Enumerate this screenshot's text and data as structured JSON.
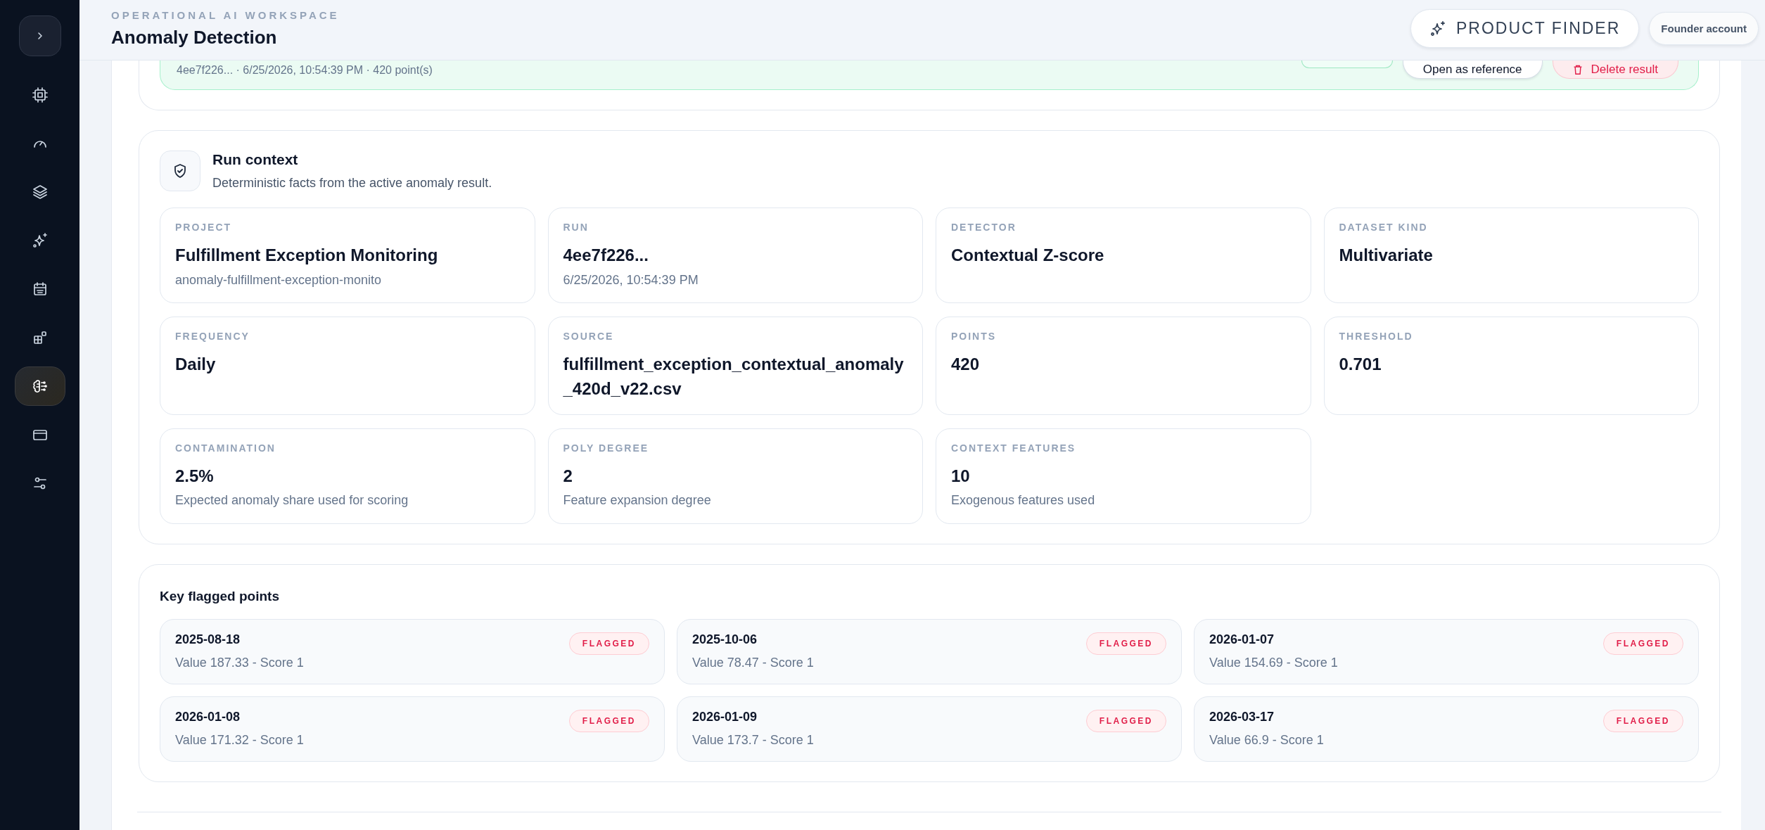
{
  "sidebar": {
    "items": [
      {
        "selected": false
      },
      {
        "selected": false
      },
      {
        "selected": false
      },
      {
        "selected": false
      },
      {
        "selected": false
      },
      {
        "selected": false
      },
      {
        "selected": true
      },
      {
        "selected": false
      },
      {
        "selected": false
      }
    ]
  },
  "header": {
    "eyebrow": "OPERATIONAL AI WORKSPACE",
    "title": "Anomaly Detection",
    "product_finder": "PRODUCT FINDER",
    "account": "Founder account"
  },
  "result_banner": {
    "meta": "4ee7f226... · 6/25/2026, 10:54:39 PM · 420 point(s)",
    "buttons": [
      {
        "kind": "plain"
      },
      {
        "kind": "secondary",
        "label": "Open as reference"
      },
      {
        "kind": "danger",
        "label": "Delete result"
      }
    ]
  },
  "run_context": {
    "title": "Run context",
    "subtitle": "Deterministic facts from the active anomaly result.",
    "facts": [
      {
        "label": "PROJECT",
        "value": "Fulfillment Exception Monitoring",
        "detail": "anomaly-fulfillment-exception-monito"
      },
      {
        "label": "RUN",
        "value": "4ee7f226...",
        "detail": "6/25/2026, 10:54:39 PM"
      },
      {
        "label": "DETECTOR",
        "value": "Contextual Z-score"
      },
      {
        "label": "DATASET KIND",
        "value": "Multivariate"
      },
      {
        "label": "FREQUENCY",
        "value": "Daily"
      },
      {
        "label": "SOURCE",
        "value": "fulfillment_exception_contextual_anomaly_420d_v22.csv"
      },
      {
        "label": "POINTS",
        "value": "420"
      },
      {
        "label": "THRESHOLD",
        "value": "0.701"
      },
      {
        "label": "CONTAMINATION",
        "value": "2.5%",
        "detail": "Expected anomaly share used for scoring"
      },
      {
        "label": "POLY DEGREE",
        "value": "2",
        "detail": "Feature expansion degree"
      },
      {
        "label": "CONTEXT FEATURES",
        "value": "10",
        "detail": "Exogenous features used"
      }
    ]
  },
  "flagged": {
    "title": "Key flagged points",
    "points": [
      {
        "date": "2025-08-18",
        "summary": "Value 187.33 - Score 1",
        "badge": "FLAGGED"
      },
      {
        "date": "2025-10-06",
        "summary": "Value 78.47 - Score 1",
        "badge": "FLAGGED"
      },
      {
        "date": "2026-01-07",
        "summary": "Value 154.69 - Score 1",
        "badge": "FLAGGED"
      },
      {
        "date": "2026-01-08",
        "summary": "Value 171.32 - Score 1",
        "badge": "FLAGGED"
      },
      {
        "date": "2026-01-09",
        "summary": "Value 173.7 - Score 1",
        "badge": "FLAGGED"
      },
      {
        "date": "2026-03-17",
        "summary": "Value 66.9 - Score 1",
        "badge": "FLAGGED"
      }
    ]
  }
}
